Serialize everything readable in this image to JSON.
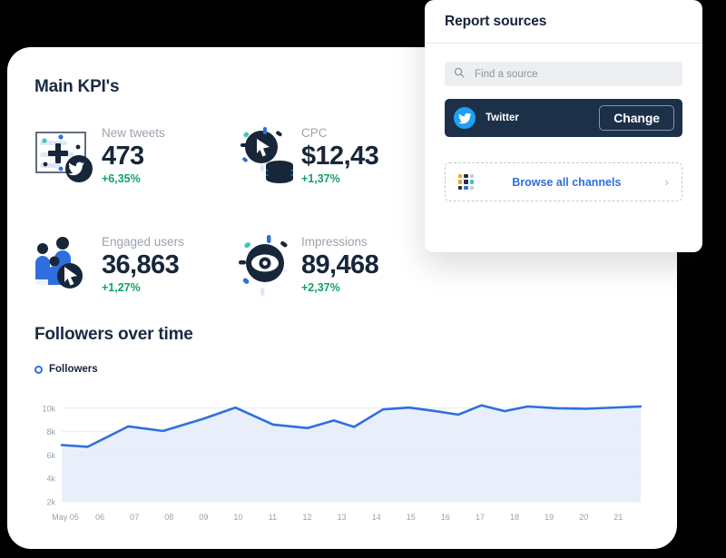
{
  "dashboard": {
    "kpi_section_title": "Main KPI's",
    "chart_section_title": "Followers over time",
    "kpis": [
      {
        "icon": "new-tweets-icon",
        "label": "New tweets",
        "value": "473",
        "delta": "+6,35%"
      },
      {
        "icon": "cpc-icon",
        "label": "CPC",
        "value": "$12,43",
        "delta": "+1,37%"
      },
      {
        "icon": "engaged-users-icon",
        "label": "Engaged users",
        "value": "36,863",
        "delta": "+1,27%"
      },
      {
        "icon": "impressions-icon",
        "label": "Impressions",
        "value": "89,468",
        "delta": "+2,37%"
      }
    ]
  },
  "chart_data": {
    "type": "area",
    "title": "Followers over time",
    "legend": [
      {
        "name": "Followers",
        "color": "#2f6fdd",
        "marker": "circle-outline"
      }
    ],
    "legend_position": "top-left",
    "xlabel": "",
    "ylabel": "",
    "grid": true,
    "ylim": [
      2000,
      11000
    ],
    "ytick_labels": [
      "10k",
      "8k",
      "6k",
      "4k",
      "2k"
    ],
    "ytick_values": [
      10000,
      8000,
      6000,
      4000,
      2000
    ],
    "categories": [
      "May 05",
      "06",
      "07",
      "08",
      "09",
      "10",
      "11",
      "12",
      "13",
      "14",
      "15",
      "16",
      "17",
      "18",
      "19",
      "20",
      "21"
    ],
    "series": [
      {
        "name": "Followers",
        "color": "#2f6fdd",
        "values": [
          6850,
          6700,
          8450,
          8050,
          9100,
          10050,
          8600,
          8300,
          8950,
          8400,
          9900,
          10050,
          9750,
          9450,
          10250,
          9750,
          10150,
          10000,
          9950,
          10150
        ]
      }
    ],
    "x_fractions": [
      0.0,
      0.045,
      0.115,
      0.175,
      0.245,
      0.3,
      0.365,
      0.425,
      0.47,
      0.505,
      0.555,
      0.6,
      0.645,
      0.685,
      0.725,
      0.765,
      0.805,
      0.855,
      0.905,
      1.0
    ]
  },
  "report_sources": {
    "title": "Report sources",
    "search": {
      "placeholder": "Find a source",
      "value": "",
      "icon": "search-icon"
    },
    "selected_source": {
      "name": "Twitter",
      "icon": "twitter-icon",
      "action_label": "Change"
    },
    "browse": {
      "label": "Browse all channels",
      "icon": "apps-grid-icon",
      "chevron": "›"
    }
  },
  "colors": {
    "accent_blue": "#2f6fdd",
    "twitter_blue": "#1da1f2",
    "dark_navy": "#1c3048",
    "positive_green": "#13a06a",
    "area_fill": "#e4ecfa"
  }
}
